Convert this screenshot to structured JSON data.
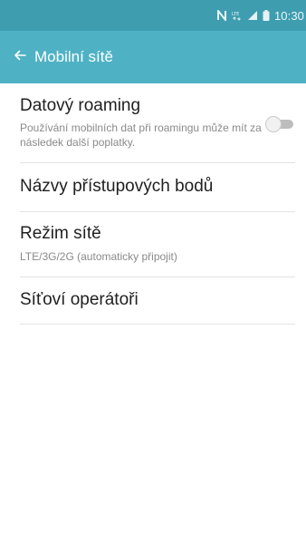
{
  "status_bar": {
    "time": "10:30",
    "icons": [
      "nfc-icon",
      "lte-icon",
      "signal-icon",
      "battery-icon"
    ],
    "color": "#3f9db0"
  },
  "action_bar": {
    "title": "Mobilní sítě",
    "back_icon": "back-arrow-icon",
    "color": "#4fb2c4"
  },
  "settings": {
    "roaming": {
      "title": "Datový roaming",
      "subtitle": "Používání mobilních dat při roamingu může mít za následek další poplatky.",
      "enabled": false
    },
    "apn": {
      "title": "Názvy přístupových bodů"
    },
    "network_mode": {
      "title": "Režim sítě",
      "value": "LTE/3G/2G (automaticky připojit)"
    },
    "operators": {
      "title": "Síťoví operátoři"
    }
  }
}
